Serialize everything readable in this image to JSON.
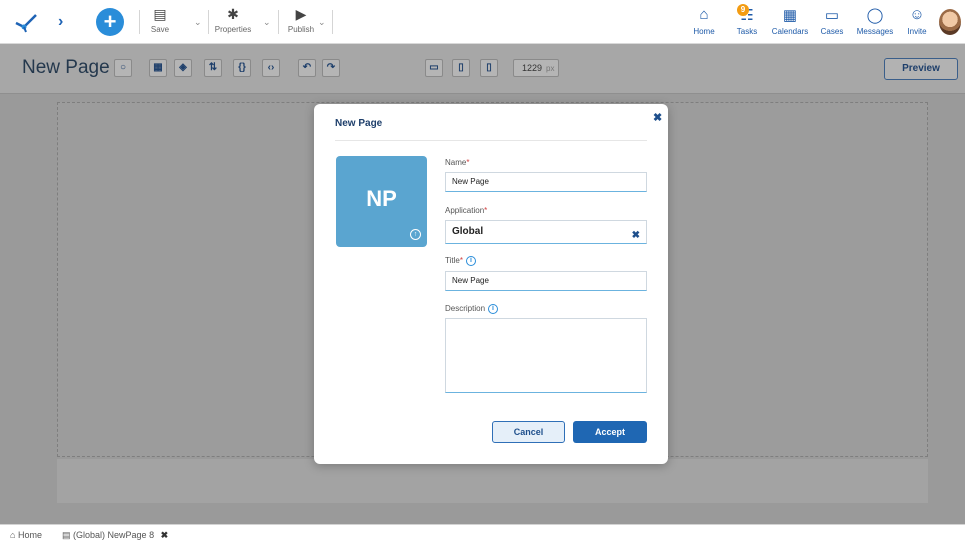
{
  "toolbar": {
    "save_label": "Save",
    "properties_label": "Properties",
    "publish_label": "Publish"
  },
  "nav": {
    "home": "Home",
    "tasks": "Tasks",
    "tasks_badge": "9",
    "calendars": "Calendars",
    "cases": "Cases",
    "messages": "Messages",
    "invite": "Invite"
  },
  "designer": {
    "page_title": "New Page",
    "width_value": "1229",
    "width_unit": "px",
    "preview_label": "Preview"
  },
  "modal": {
    "title": "New Page",
    "tile_initials": "NP",
    "name_label": "Name",
    "name_value": "New Page",
    "application_label": "Application",
    "application_value": "Global",
    "title_label": "Title",
    "title_value": "New Page",
    "description_label": "Description",
    "description_value": "",
    "cancel_label": "Cancel",
    "accept_label": "Accept",
    "required_mark": "*"
  },
  "tabs": {
    "home": "Home",
    "page_tab": "(Global) NewPage 8"
  },
  "colors": {
    "accent": "#1f67b3",
    "tile": "#5aa5d0",
    "badge": "#f39c12"
  }
}
